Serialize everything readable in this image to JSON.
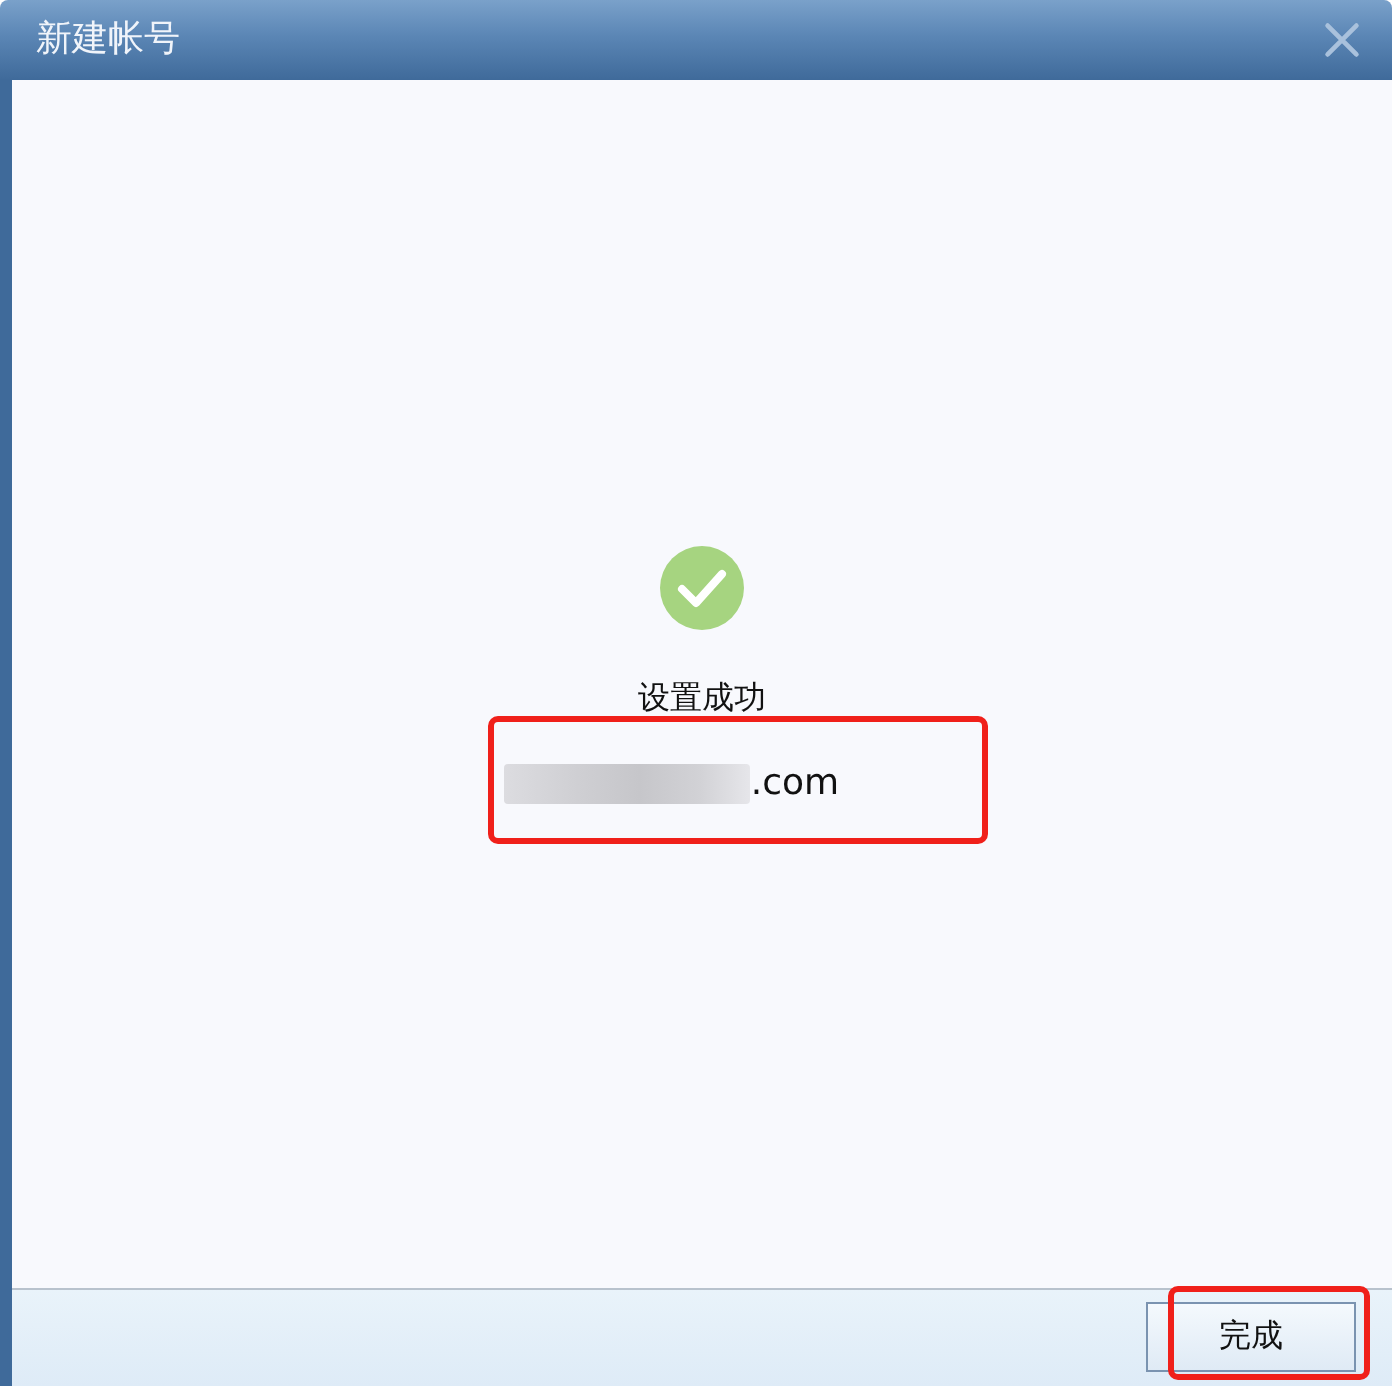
{
  "window": {
    "title": "新建帐号"
  },
  "result": {
    "kind": "success",
    "message": "设置成功",
    "account": {
      "redacted": true,
      "visible_text": ".com",
      "highlighted": true
    }
  },
  "footer": {
    "buttons": [
      {
        "label": "完成",
        "highlighted": true
      }
    ]
  }
}
